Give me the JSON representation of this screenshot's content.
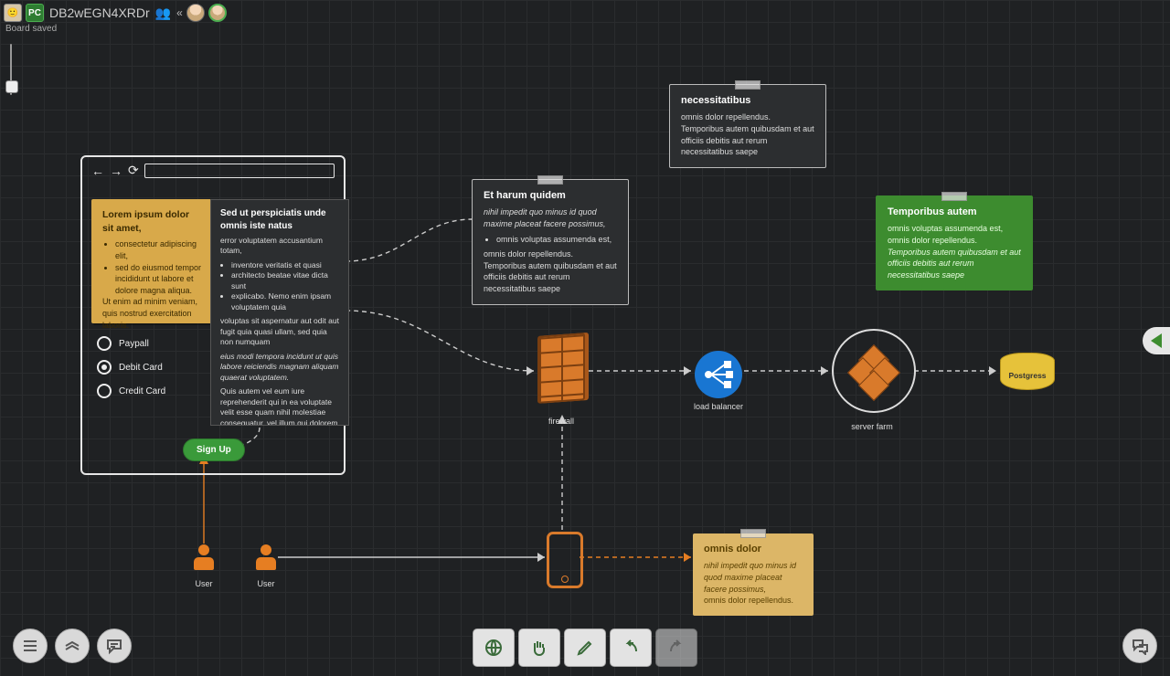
{
  "header": {
    "board_name": "DB2wEGN4XRDr",
    "status": "Board saved",
    "pc_badge": "PC"
  },
  "browser_card": {
    "sticky": {
      "title": "Lorem ipsum dolor sit amet,",
      "items": [
        "consectetur adipiscing elit,",
        "sed do eiusmod tempor incididunt ut labore et dolore magna aliqua."
      ],
      "footer": "Ut enim ad minim veniam, quis nostrud exercitation laboris."
    },
    "text": {
      "title": "Sed ut perspiciatis unde omnis iste natus",
      "lead": "error voluptatem accusantium totam,",
      "bullets": [
        "inventore veritatis et quasi",
        "architecto beatae vitae dicta sunt",
        "explicabo. Nemo enim ipsam voluptatem quia"
      ],
      "p1": "voluptas sit aspernatur aut odit aut fugit quia quasi ullam, sed quia non numquam",
      "p2_em": "eius modi tempora incidunt ut quis labore reiciendis magnam aliquam quaerat voluptatem.",
      "p3": "Quis autem vel eum iure reprehenderit qui in ea voluptate velit esse quam nihil molestiae consequatur, vel illum qui dolorem eum fugiat quo voluptas nulla pariatur?\""
    },
    "radios": {
      "r1": "Paypall",
      "r2": "Debit Card",
      "r3": "Credit Card"
    },
    "signup": "Sign Up"
  },
  "notes": {
    "harum": {
      "title": "Et harum quidem",
      "em": "nihil impedit quo minus id quod maxime placeat facere possimus,",
      "bullet": "omnis voluptas assumenda est,",
      "body": "omnis dolor repellendus. Temporibus autem quibusdam et aut officiis debitis aut rerum necessitatibus saepe"
    },
    "necess": {
      "title": "necessitatibus",
      "body": "omnis dolor repellendus. Temporibus autem quibusdam et aut officiis debitis aut rerum necessitatibus saepe"
    },
    "green": {
      "title": "Temporibus autem",
      "line1": "omnis voluptas assumenda est, omnis dolor repellendus.",
      "line2_em": "Temporibus autem quibusdam et aut officiis debitis aut rerum necessitatibus saepe"
    },
    "sand": {
      "title": "omnis dolor",
      "line1_em": "nihil impedit quo minus id quod maxime placeat facere possimus,",
      "line2": "omnis dolor repellendus."
    }
  },
  "labels": {
    "user1": "User",
    "user2": "User",
    "firewall": "firewall",
    "lb": "load balancer",
    "farm": "server farm",
    "db": "Postgress"
  }
}
